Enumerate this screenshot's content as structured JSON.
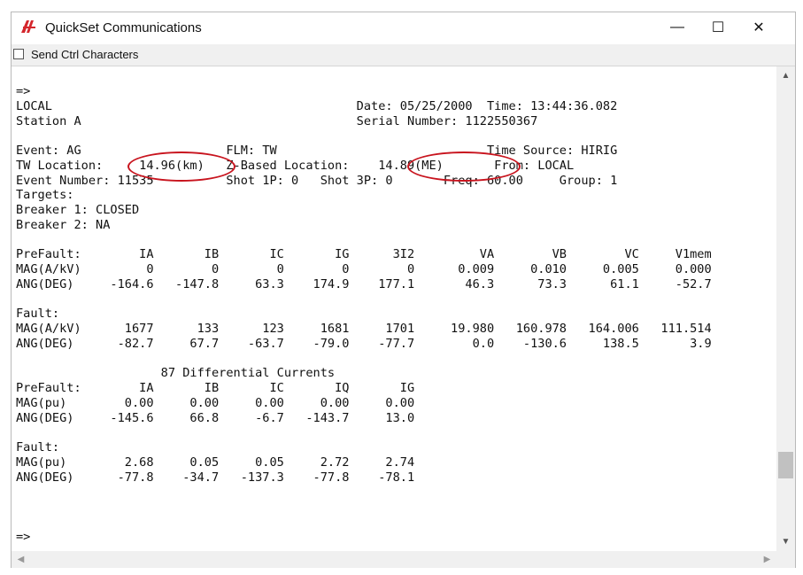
{
  "window": {
    "title": "QuickSet Communications",
    "minimize_glyph": "—",
    "maximize_glyph": "☐",
    "close_glyph": "✕"
  },
  "toolbar": {
    "send_ctrl_label": "Send Ctrl Characters",
    "send_ctrl_checked": false
  },
  "terminal": {
    "lines": [
      "=>",
      "LOCAL                                          Date: 05/25/2000  Time: 13:44:36.082",
      "Station A                                      Serial Number: 1122550367",
      "",
      "Event: AG                    FLM: TW                             Time Source: HIRIG",
      "TW Location:     14.96(km)   Z-Based Location:    14.89(ME)       From: LOCAL",
      "Event Number: 11535          Shot 1P: 0   Shot 3P: 0       Freq: 60.00     Group: 1",
      "Targets:",
      "Breaker 1: CLOSED",
      "Breaker 2: NA",
      "",
      "PreFault:        IA       IB       IC       IG      3I2         VA        VB        VC     V1mem",
      "MAG(A/kV)         0        0        0        0        0      0.009     0.010     0.005     0.000",
      "ANG(DEG)     -164.6   -147.8     63.3    174.9    177.1       46.3      73.3      61.1     -52.7",
      "",
      "Fault:",
      "MAG(A/kV)      1677      133      123     1681     1701     19.980   160.978   164.006   111.514",
      "ANG(DEG)      -82.7     67.7    -63.7    -79.0    -77.7        0.0    -130.6     138.5       3.9",
      "",
      "                    87 Differential Currents",
      "PreFault:        IA       IB       IC       IQ       IG",
      "MAG(pu)        0.00     0.00     0.00     0.00     0.00",
      "ANG(DEG)     -145.6     66.8     -6.7   -143.7     13.0",
      "",
      "Fault:",
      "MAG(pu)        2.68     0.05     0.05     2.72     2.74",
      "ANG(DEG)      -77.8    -34.7   -137.3    -77.8    -78.1",
      "",
      "",
      "",
      "=>"
    ]
  },
  "annotations": {
    "color": "#c8141e",
    "circled_values": [
      "14.96(km)",
      "14.89(ME)"
    ]
  },
  "scrollbars": {
    "up_arrow": "▲",
    "down_arrow": "▼",
    "left_arrow": "◀",
    "right_arrow": "▶"
  },
  "colors": {
    "brand_icon": "#d4262c",
    "scroll_thumb": "#c1c1c1"
  }
}
